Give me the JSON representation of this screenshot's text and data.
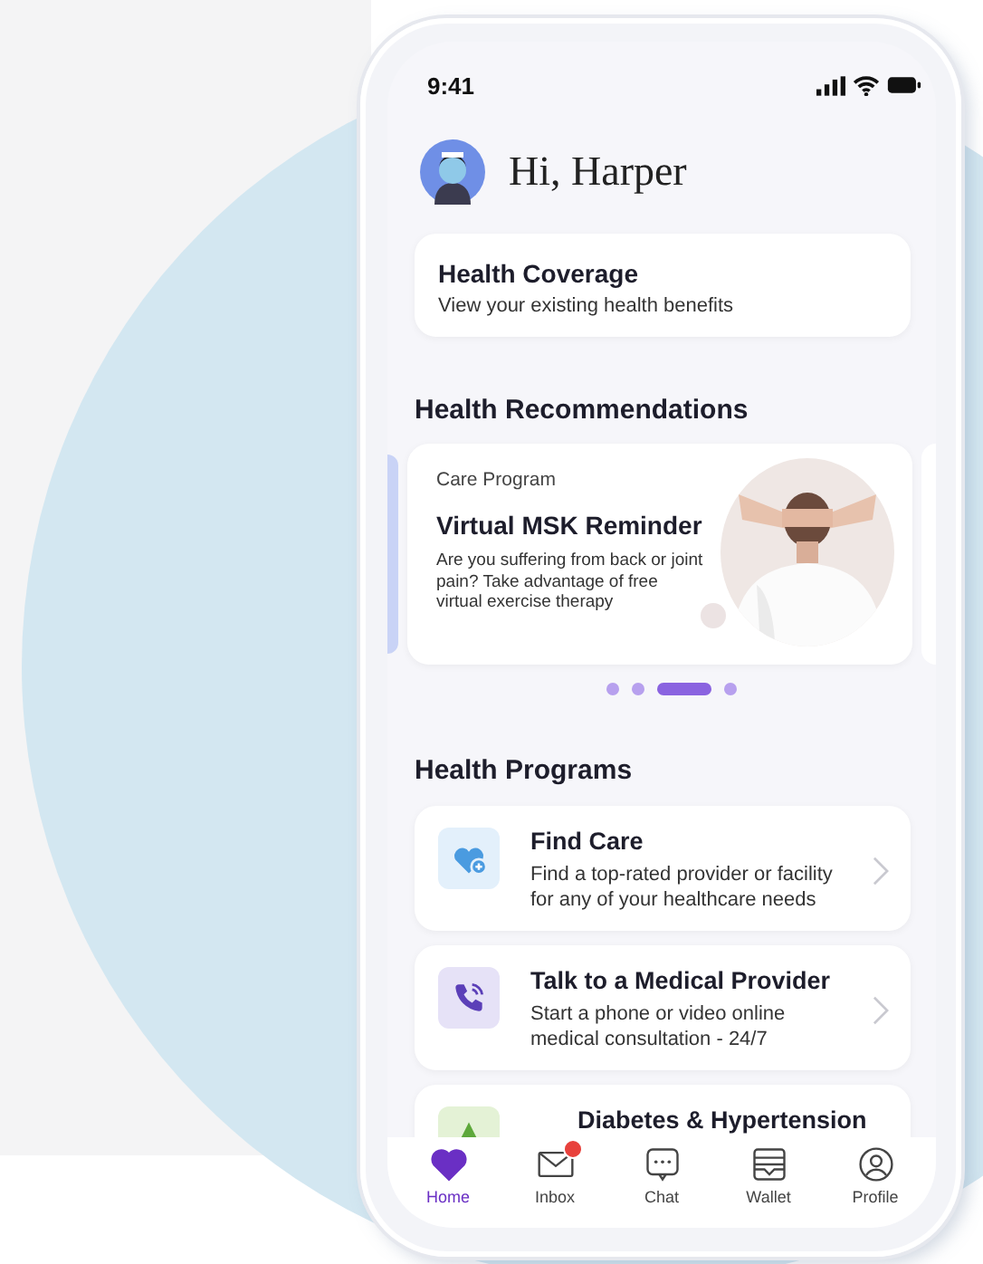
{
  "status_bar": {
    "time": "9:41"
  },
  "greeting": "Hi, Harper",
  "coverage_card": {
    "title": "Health Coverage",
    "subtitle": "View your existing health benefits"
  },
  "recommendations": {
    "heading": "Health Recommendations",
    "card": {
      "eyebrow": "Care Program",
      "title": "Virtual MSK Reminder",
      "description": "Are you suffering from back or joint pain? Take advantage of free virtual exercise therapy",
      "kind": "picture"
    },
    "dots": [
      {
        "selected": false
      },
      {
        "selected": false
      },
      {
        "selected": true
      },
      {
        "selected": false
      }
    ]
  },
  "programs": {
    "heading": "Health Programs",
    "items": [
      {
        "kind": "care",
        "title": "Find Care",
        "description": "Find a top-rated provider or facility for any of your healthcare needs"
      },
      {
        "kind": "call",
        "title": "Talk to a Medical Provider",
        "description": "Start a phone or video online medical consultation - 24/7"
      },
      {
        "kind": "chronic",
        "title": "Diabetes & Hypertension"
      }
    ]
  },
  "tab_bar": [
    {
      "kind": "home",
      "label": "Home",
      "selected": true,
      "badge": false
    },
    {
      "kind": "inbox",
      "label": "Inbox",
      "selected": false,
      "badge": true
    },
    {
      "kind": "chat",
      "label": "Chat",
      "selected": false,
      "badge": false
    },
    {
      "kind": "wallet",
      "label": "Wallet",
      "selected": false,
      "badge": false
    },
    {
      "kind": "profile",
      "label": "Profile",
      "selected": false,
      "badge": false
    }
  ]
}
